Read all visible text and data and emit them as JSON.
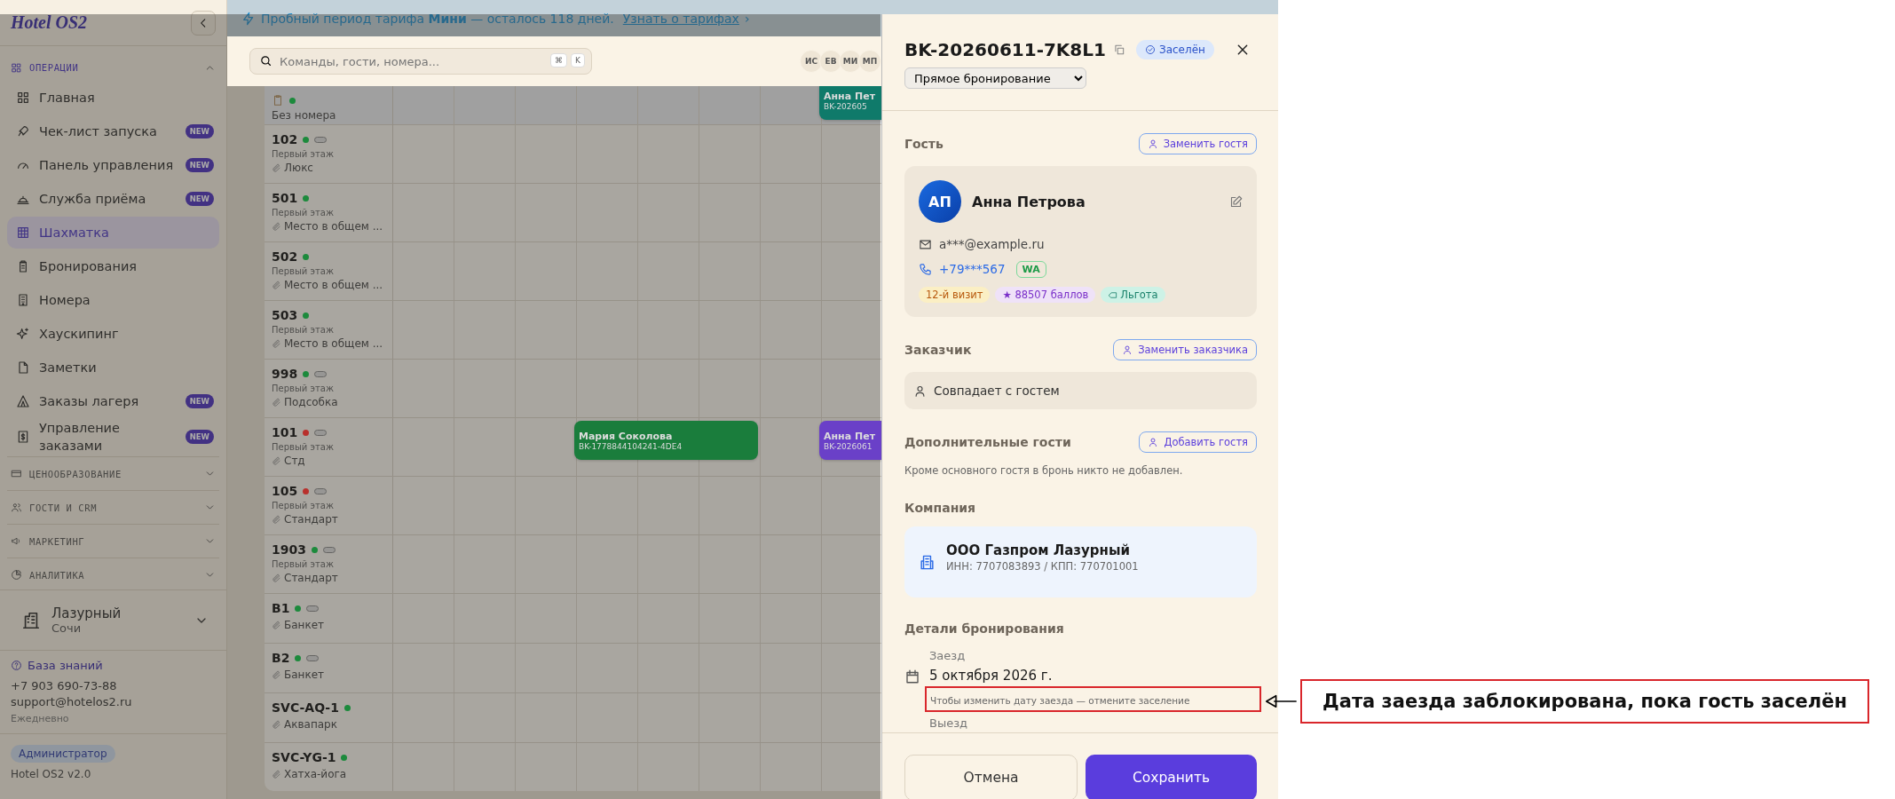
{
  "banner": {
    "text": "Пробный период тарифа **Мини** — осталось 118 дней.",
    "link": "Узнать о тарифах",
    "chevron": "›"
  },
  "sidebar": {
    "logo": "Hotel OS2",
    "sections": [
      {
        "title": "ОПЕРАЦИИ",
        "expanded": true,
        "items": [
          {
            "label": "Главная",
            "selected": false
          },
          {
            "label": "Чек-лист запуска",
            "badge": "NEW",
            "selected": false
          },
          {
            "label": "Панель управления",
            "badge": "NEW",
            "selected": false
          },
          {
            "label": "Служба приёма",
            "badge": "NEW",
            "selected": false
          },
          {
            "label": "Шахматка",
            "selected": true
          },
          {
            "label": "Бронирования",
            "selected": false
          },
          {
            "label": "Номера",
            "selected": false
          },
          {
            "label": "Хаускипинг",
            "selected": false
          },
          {
            "label": "Заметки",
            "selected": false
          },
          {
            "label": "Заказы лагеря",
            "badge": "NEW",
            "selected": false
          },
          {
            "label": "Управление заказами",
            "badge": "NEW",
            "selected": false
          }
        ]
      },
      {
        "title": "ЦЕНООБРАЗОВАНИЕ",
        "expanded": false
      },
      {
        "title": "ГОСТИ И CRM",
        "expanded": false
      },
      {
        "title": "МАРКЕТИНГ",
        "expanded": false
      },
      {
        "title": "АНАЛИТИКА",
        "expanded": false
      }
    ],
    "property": {
      "name": "Лазурный",
      "city": "Сочи"
    },
    "help": {
      "link": "База знаний",
      "phone": "+7 903 690-73-88",
      "email": "support@hotelos2.ru",
      "hours": "Ежедневно"
    },
    "role": "Администратор",
    "version": "Hotel OS2 v2.0"
  },
  "header": {
    "search": {
      "placeholder": "Команды, гости, номера...",
      "keys": [
        "⌘",
        "K"
      ]
    },
    "avatars": [
      "ИС",
      "ЕВ",
      "МИ",
      "МП"
    ]
  },
  "grid": {
    "rooms": [
      {
        "kind": "unassigned",
        "label": "Без номера",
        "color": "#1c8a3c",
        "bookings": [
          {
            "name": "Анна Пет",
            "code": "BK-202605",
            "color": "#0f7a6a"
          }
        ]
      },
      {
        "kind": "room",
        "number": "102",
        "color": "#1c8a3c",
        "pill": true,
        "floor": "Первый этаж",
        "type": "Люкс"
      },
      {
        "kind": "room",
        "number": "501",
        "color": "#1c8a3c",
        "floor": "Первый этаж",
        "type": "Место в общем ..."
      },
      {
        "kind": "room",
        "number": "502",
        "color": "#1c8a3c",
        "floor": "Первый этаж",
        "type": "Место в общем ..."
      },
      {
        "kind": "room",
        "number": "503",
        "color": "#1c8a3c",
        "floor": "Первый этаж",
        "type": "Место в общем ..."
      },
      {
        "kind": "room",
        "number": "998",
        "color": "#1c8a3c",
        "pill": true,
        "floor": "Первый этаж",
        "type": "Подсобка"
      },
      {
        "kind": "room",
        "number": "101",
        "color": "#b8302c",
        "pill": true,
        "floor": "Первый этаж",
        "type": "Стд",
        "bookings": [
          {
            "name": "Мария Соколова",
            "code": "BK-1778844104241-4DE4",
            "color": "#1a7d3c"
          },
          {
            "name": "Анна Пет",
            "code": "BK-2026061",
            "color": "#6a40c8"
          }
        ]
      },
      {
        "kind": "room",
        "number": "105",
        "color": "#b8302c",
        "pill": true,
        "floor": "Первый этаж",
        "type": "Стандарт"
      },
      {
        "kind": "room",
        "number": "1903",
        "color": "#1c8a3c",
        "pill": true,
        "floor": "Первый этаж",
        "type": "Стандарт"
      },
      {
        "kind": "room",
        "number": "B1",
        "color": "#1c8a3c",
        "pill": true,
        "type": "Банкет"
      },
      {
        "kind": "room",
        "number": "B2",
        "color": "#1c8a3c",
        "pill": true,
        "type": "Банкет"
      },
      {
        "kind": "room",
        "number": "SVC-AQ-1",
        "color": "#1c8a3c",
        "type": "Аквапарк"
      },
      {
        "kind": "room",
        "number": "SVC-YG-1",
        "color": "#1c8a3c",
        "type": "Хатха-йога"
      }
    ]
  },
  "drawer": {
    "code": "BK-20260611-7K8L1",
    "status": "Заселён",
    "source": "Прямое бронирование",
    "guest": {
      "title": "Гость",
      "action": "Заменить гостя",
      "initials": "АП",
      "name": "Анна Петрова",
      "email": "a***@example.ru",
      "phone": "+79***567",
      "messenger": "WA",
      "tags": [
        {
          "kind": "visits",
          "label": "12-й визит"
        },
        {
          "kind": "points",
          "label": "★ 88507 баллов"
        },
        {
          "kind": "benefit",
          "label": "Льгота"
        }
      ]
    },
    "customer": {
      "title": "Заказчик",
      "action": "Заменить заказчика",
      "value": "Совпадает с гостем"
    },
    "extra": {
      "title": "Дополнительные гости",
      "action": "Добавить гостя",
      "note": "Кроме основного гостя в бронь никто не добавлен."
    },
    "company": {
      "title": "Компания",
      "name": "ООО Газпром Лазурный",
      "details": "ИНН: 7707083893 / КПП: 770701001"
    },
    "details": {
      "title": "Детали бронирования",
      "checkin_label": "Заезд",
      "checkin_value": "5 октября 2026 г.",
      "checkin_hint": "Чтобы изменить дату заезда — отмените заселение",
      "checkout_label": "Выезд"
    },
    "buttons": {
      "cancel": "Отмена",
      "save": "Сохранить"
    }
  },
  "annotation": {
    "text": "Дата заезда заблокирована, пока гость заселён"
  }
}
